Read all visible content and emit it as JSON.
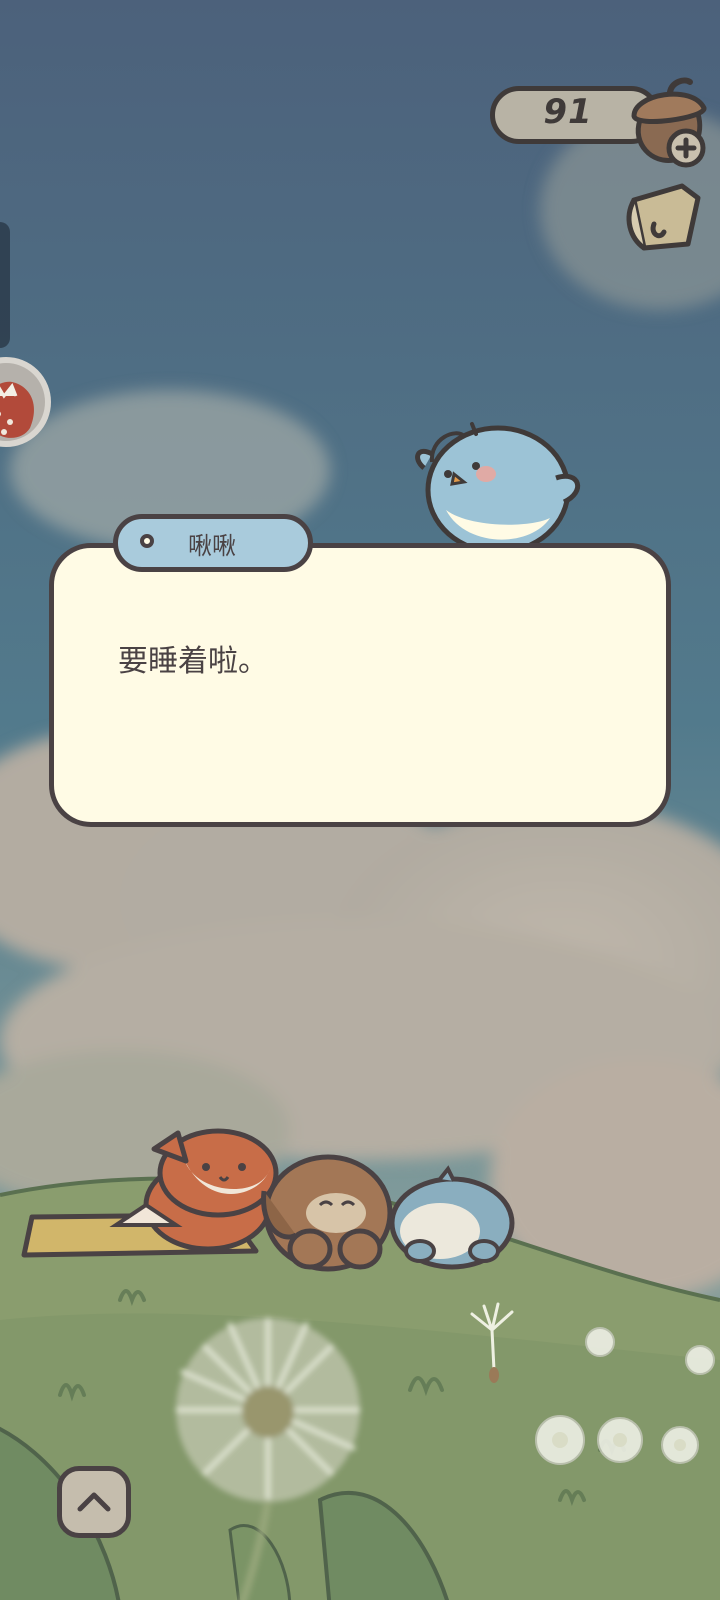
{
  "hud": {
    "currency": {
      "value": "91",
      "icon": "acorn-icon",
      "add_icon": "plus-icon"
    },
    "secondary_button_icon": "scroll-icon",
    "side_button_icon": "strawberry-icon"
  },
  "dialog": {
    "speaker": "啾啾",
    "text": "要睡着啦。"
  },
  "bottom": {
    "expand_icon": "chevron-up-icon"
  },
  "colors": {
    "sky": "#4f6580",
    "dialog_bg": "#fffbe5",
    "name_tag_bg": "#a9cbdc",
    "outline": "#4a4244",
    "grass": "#8a9d6e"
  }
}
